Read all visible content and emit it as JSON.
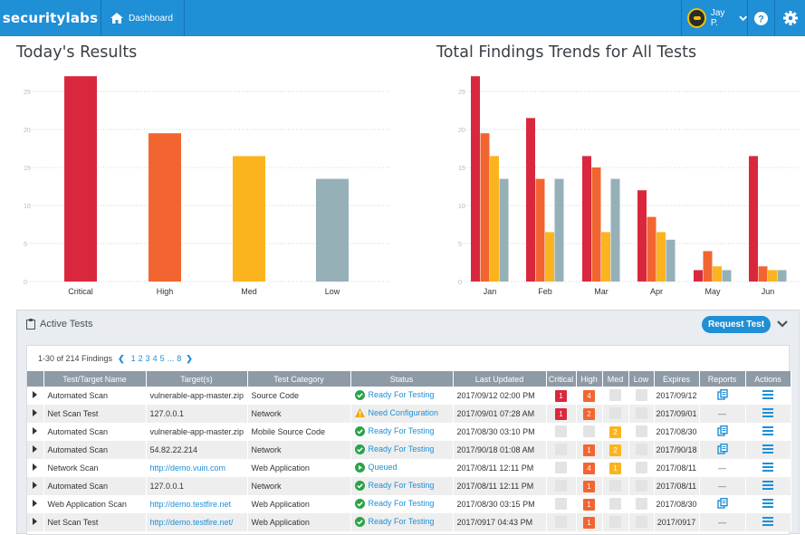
{
  "topbar": {
    "brand": "securitylabs",
    "nav_dashboard": "Dashboard",
    "user_name": "Jay P."
  },
  "colors": {
    "brand": "#1f8fd6",
    "critical": "#d9283e",
    "high": "#f26531",
    "med": "#fbb41e",
    "low": "#96b0b8"
  },
  "today": {
    "title": "Today's Results"
  },
  "trends": {
    "title": "Total Findings Trends for All Tests"
  },
  "chart_data": [
    {
      "type": "bar",
      "title": "Today's Results",
      "categories": [
        "Critical",
        "High",
        "Med",
        "Low"
      ],
      "values": [
        27,
        19.5,
        16.5,
        13.5
      ],
      "ylim": [
        0,
        25
      ],
      "yticks": [
        "0",
        "5",
        "10",
        "15",
        "20",
        "25"
      ],
      "grid": true
    },
    {
      "type": "bar",
      "title": "Total Findings Trends for All Tests",
      "categories": [
        "Jan",
        "Feb",
        "Mar",
        "Apr",
        "May",
        "Jun"
      ],
      "series": [
        {
          "values": [
            27,
            21.5,
            16.5,
            12,
            1.5,
            16.5
          ]
        },
        {
          "values": [
            19.5,
            13.5,
            15,
            8.5,
            4,
            2
          ]
        },
        {
          "values": [
            16.5,
            6.5,
            6.5,
            6.5,
            2,
            1.5
          ]
        },
        {
          "values": [
            13.5,
            13.5,
            13.5,
            5.5,
            1.5,
            1.5
          ]
        }
      ],
      "ylim": [
        0,
        25
      ],
      "yticks": [
        "0",
        "5",
        "10",
        "15",
        "20",
        "25"
      ],
      "grid": true
    }
  ],
  "tests": {
    "title": "Active Tests",
    "request_button": "Request Test",
    "pager_summary": "1-30 of 214 Findings",
    "pages": [
      "1",
      "2",
      "3",
      "4",
      "5",
      "...",
      "8"
    ],
    "columns": [
      "Test/Target Name",
      "Target(s)",
      "Test Category",
      "Status",
      "Last Updated",
      "Critical",
      "High",
      "Med",
      "Low",
      "Expires",
      "Reports",
      "Actions"
    ],
    "rows": [
      {
        "name": "Automated Scan",
        "target": "vulnerable-app-master.zip",
        "target_link": false,
        "category": "Source Code",
        "status": "Ready For Testing",
        "status_icon": "check",
        "updated": "2017/09/12 02:00 PM",
        "critical": "1",
        "high": "4",
        "med": "",
        "low": "",
        "expires": "2017/09/12",
        "report": "reports-icon"
      },
      {
        "name": "Net Scan Test",
        "target": "127.0.0.1",
        "target_link": false,
        "category": "Network",
        "status": "Need Configuration",
        "status_icon": "warning",
        "updated": "2017/09/01 07:28 AM",
        "critical": "1",
        "high": "2",
        "med": "",
        "low": "",
        "expires": "2017/09/01",
        "report": "—"
      },
      {
        "name": "Automated Scan",
        "target": "vulnerable-app-master.zip",
        "target_link": false,
        "category": "Mobile Source Code",
        "status": "Ready For Testing",
        "status_icon": "check",
        "updated": "2017/08/30 03:10 PM",
        "critical": "",
        "high": "",
        "med": "2",
        "low": "",
        "expires": "2017/08/30",
        "report": "reports-icon"
      },
      {
        "name": "Automated Scan",
        "target": "54.82.22.214",
        "target_link": false,
        "category": "Network",
        "status": "Ready For Testing",
        "status_icon": "check",
        "updated": "2017/90/18 01:08 AM",
        "critical": "",
        "high": "1",
        "med": "2",
        "low": "",
        "expires": "2017/90/18",
        "report": "reports-icon"
      },
      {
        "name": "Network Scan",
        "target": "http://demo.vuin.com",
        "target_link": true,
        "category": "Web Application",
        "status": "Queued",
        "status_icon": "play",
        "updated": "2017/08/11 12:11 PM",
        "critical": "",
        "high": "4",
        "med": "1",
        "low": "",
        "expires": "2017/08/11",
        "report": "—"
      },
      {
        "name": "Automated Scan",
        "target": "127.0.0.1",
        "target_link": false,
        "category": "Network",
        "status": "Ready For Testing",
        "status_icon": "check",
        "updated": "2017/08/11 12:11 PM",
        "critical": "",
        "high": "1",
        "med": "",
        "low": "",
        "expires": "2017/08/11",
        "report": "—"
      },
      {
        "name": "Web Application Scan",
        "target": "http://demo.testfire.net",
        "target_link": true,
        "category": "Web Application",
        "status": "Ready For Testing",
        "status_icon": "check",
        "updated": "2017/08/30 03:15 PM",
        "critical": "",
        "high": "1",
        "med": "",
        "low": "",
        "expires": "2017/08/30",
        "report": "reports-icon"
      },
      {
        "name": "Net Scan Test",
        "target": "http://demo.testfire.net/",
        "target_link": true,
        "category": "Web Application",
        "status": "Ready For Testing",
        "status_icon": "check",
        "updated": "2017/0917 04:43 PM",
        "critical": "",
        "high": "1",
        "med": "",
        "low": "",
        "expires": "2017/0917",
        "report": "—"
      }
    ]
  }
}
